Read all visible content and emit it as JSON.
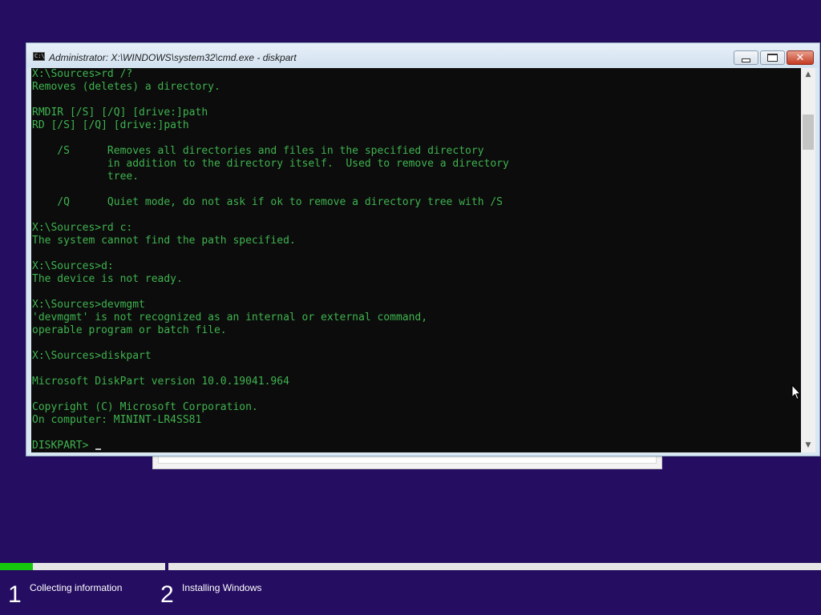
{
  "window": {
    "title": "Administrator: X:\\WINDOWS\\system32\\cmd.exe - diskpart",
    "app_icon": "cmd-icon",
    "icon_text": "C:\\",
    "close_glyph": "✕"
  },
  "console": {
    "prompt": "DISKPART> ",
    "lines": [
      "X:\\Sources>rd /?",
      "Removes (deletes) a directory.",
      "",
      "RMDIR [/S] [/Q] [drive:]path",
      "RD [/S] [/Q] [drive:]path",
      "",
      "    /S      Removes all directories and files in the specified directory",
      "            in addition to the directory itself.  Used to remove a directory",
      "            tree.",
      "",
      "    /Q      Quiet mode, do not ask if ok to remove a directory tree with /S",
      "",
      "X:\\Sources>rd c:",
      "The system cannot find the path specified.",
      "",
      "X:\\Sources>d:",
      "The device is not ready.",
      "",
      "X:\\Sources>devmgmt",
      "'devmgmt' is not recognized as an internal or external command,",
      "operable program or batch file.",
      "",
      "X:\\Sources>diskpart",
      "",
      "Microsoft DiskPart version 10.0.19041.964",
      "",
      "Copyright (C) Microsoft Corporation.",
      "On computer: MININT-LR4SS81",
      ""
    ]
  },
  "colors": {
    "desktop": "#250d62",
    "console_text": "#3fb34f",
    "progress": "#16c60c"
  },
  "setup": {
    "steps": [
      {
        "number": "1",
        "label": "Collecting information",
        "progress": 0.2
      },
      {
        "number": "2",
        "label": "Installing Windows",
        "progress": 0
      }
    ]
  }
}
